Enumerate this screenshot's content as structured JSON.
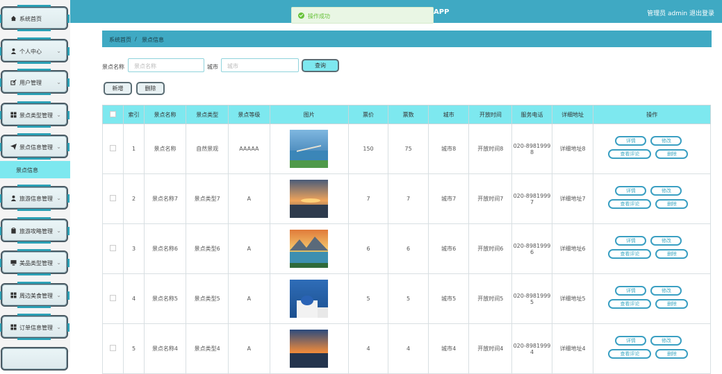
{
  "sidebar": {
    "items": [
      {
        "label": "系统首页",
        "icon": "home-icon",
        "expandable": false
      },
      {
        "label": "个人中心",
        "icon": "user-icon",
        "expandable": true
      },
      {
        "label": "用户管理",
        "icon": "edit-icon",
        "expandable": true
      },
      {
        "label": "景点类型管理",
        "icon": "grid-icon",
        "expandable": true
      },
      {
        "label": "景点信息管理",
        "icon": "send-icon",
        "expandable": true
      },
      {
        "label": "旅游信息管理",
        "icon": "user-icon",
        "expandable": true
      },
      {
        "label": "旅游攻略管理",
        "icon": "clipboard-icon",
        "expandable": true
      },
      {
        "label": "美品类型管理",
        "icon": "monitor-icon",
        "expandable": true
      },
      {
        "label": "周边美食管理",
        "icon": "grid-icon",
        "expandable": true
      },
      {
        "label": "订单信息管理",
        "icon": "grid-icon",
        "expandable": true
      }
    ],
    "submenu_label": "景点信息"
  },
  "header": {
    "app_title": "APP",
    "user_text": "管理员 admin 退出登录",
    "toast": "操作成功"
  },
  "breadcrumb": {
    "home": "系统首页",
    "sep": "/",
    "current": "景点信息"
  },
  "search": {
    "name_label": "景点名称",
    "name_placeholder": "景点名称",
    "city_label": "城市",
    "city_placeholder": "城市",
    "search_button": "查询"
  },
  "actions": {
    "add_button": "新增",
    "delete_button": "删除"
  },
  "table": {
    "headers": [
      "",
      "索引",
      "景点名称",
      "景点类型",
      "景点等级",
      "图片",
      "票价",
      "票数",
      "城市",
      "开放时间",
      "服务电话",
      "详细地址",
      "操作"
    ],
    "rows": [
      {
        "index": "1",
        "name": "景点名称",
        "type": "自然景观",
        "level": "AAAAA",
        "price": "150",
        "tickets": "75",
        "city": "城市8",
        "open": "开放时间8",
        "phone": "020-89819998",
        "address": "详细地址8",
        "photo": "pier"
      },
      {
        "index": "2",
        "name": "景点名称7",
        "type": "景点类型7",
        "level": "A",
        "price": "7",
        "tickets": "7",
        "city": "城市7",
        "open": "开放时间7",
        "phone": "020-89819997",
        "address": "详细地址7",
        "photo": "sunset"
      },
      {
        "index": "3",
        "name": "景点名称6",
        "type": "景点类型6",
        "level": "A",
        "price": "6",
        "tickets": "6",
        "city": "城市6",
        "open": "开放时间6",
        "phone": "020-89819996",
        "address": "详细地址6",
        "photo": "lake"
      },
      {
        "index": "4",
        "name": "景点名称5",
        "type": "景点类型5",
        "level": "A",
        "price": "5",
        "tickets": "5",
        "city": "城市5",
        "open": "开放时间5",
        "phone": "020-89819995",
        "address": "详细地址5",
        "photo": "santorini"
      },
      {
        "index": "5",
        "name": "景点名称4",
        "type": "景点类型4",
        "level": "A",
        "price": "4",
        "tickets": "4",
        "city": "城市4",
        "open": "开放时间4",
        "phone": "020-89819994",
        "address": "详细地址4",
        "photo": "dusk"
      }
    ],
    "row_actions": {
      "detail": "详情",
      "edit": "修改",
      "reviews": "查看评论",
      "delete": "删除"
    }
  },
  "colors": {
    "header": "#3fa9c3",
    "accent_cyan": "#7de8ef",
    "success": "#67c23a"
  }
}
